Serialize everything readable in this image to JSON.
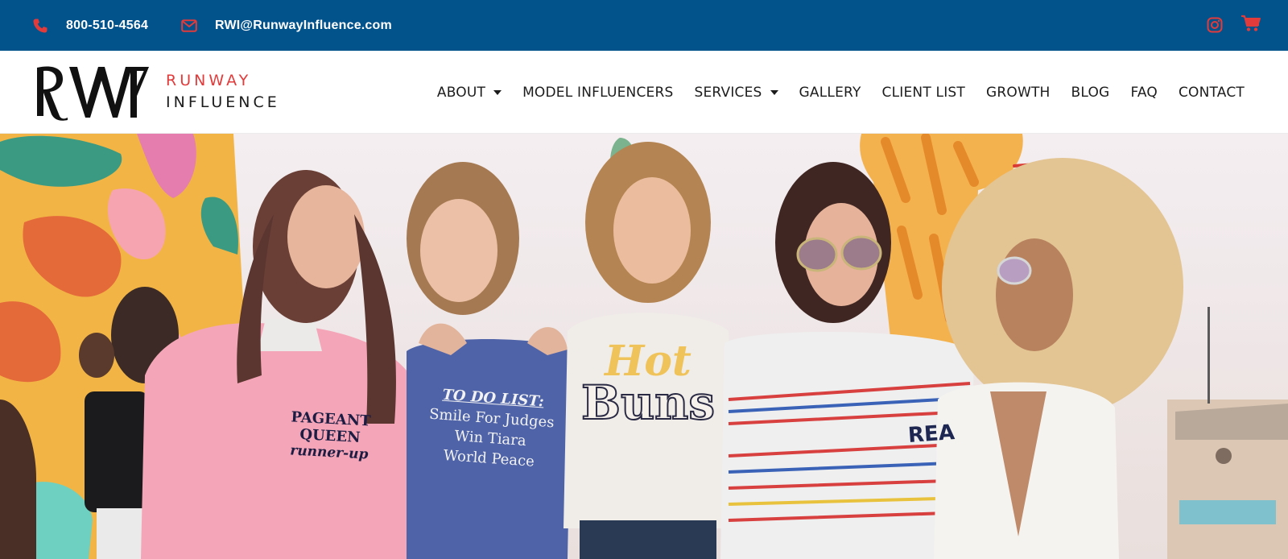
{
  "topbar": {
    "phone": "800-510-4564",
    "email": "RWI@RunwayInfluence.com",
    "phone_icon": "phone-icon",
    "email_icon": "envelope-icon",
    "social_icon": "instagram-icon",
    "cart_icon": "shopping-cart-icon"
  },
  "logo": {
    "mark": "RWI",
    "line1": "RUNWAY",
    "line2": "INFLUENCE"
  },
  "nav": {
    "about": "ABOUT",
    "model_influencers": "MODEL INFLUENCERS",
    "services": "SERVICES",
    "gallery": "GALLERY",
    "client_list": "CLIENT LIST",
    "growth": "GROWTH",
    "blog": "BLOG",
    "faq": "FAQ",
    "contact": "CONTACT"
  },
  "hero": {
    "shirt_1_line1": "PAGEANT QUEEN",
    "shirt_1_line2": "runner-up",
    "shirt_2_line1": "TO DO LIST:",
    "shirt_2_line2": "Smile For Judges",
    "shirt_2_line3": "Win Tiara",
    "shirt_2_line4": "World Peace",
    "shirt_3_line1": "Hot",
    "shirt_3_line2": "Buns",
    "shirt_4_text": "REA"
  },
  "colors": {
    "topbar": "#02528c",
    "accent": "#e13b3b",
    "text": "#1c1c1c"
  }
}
